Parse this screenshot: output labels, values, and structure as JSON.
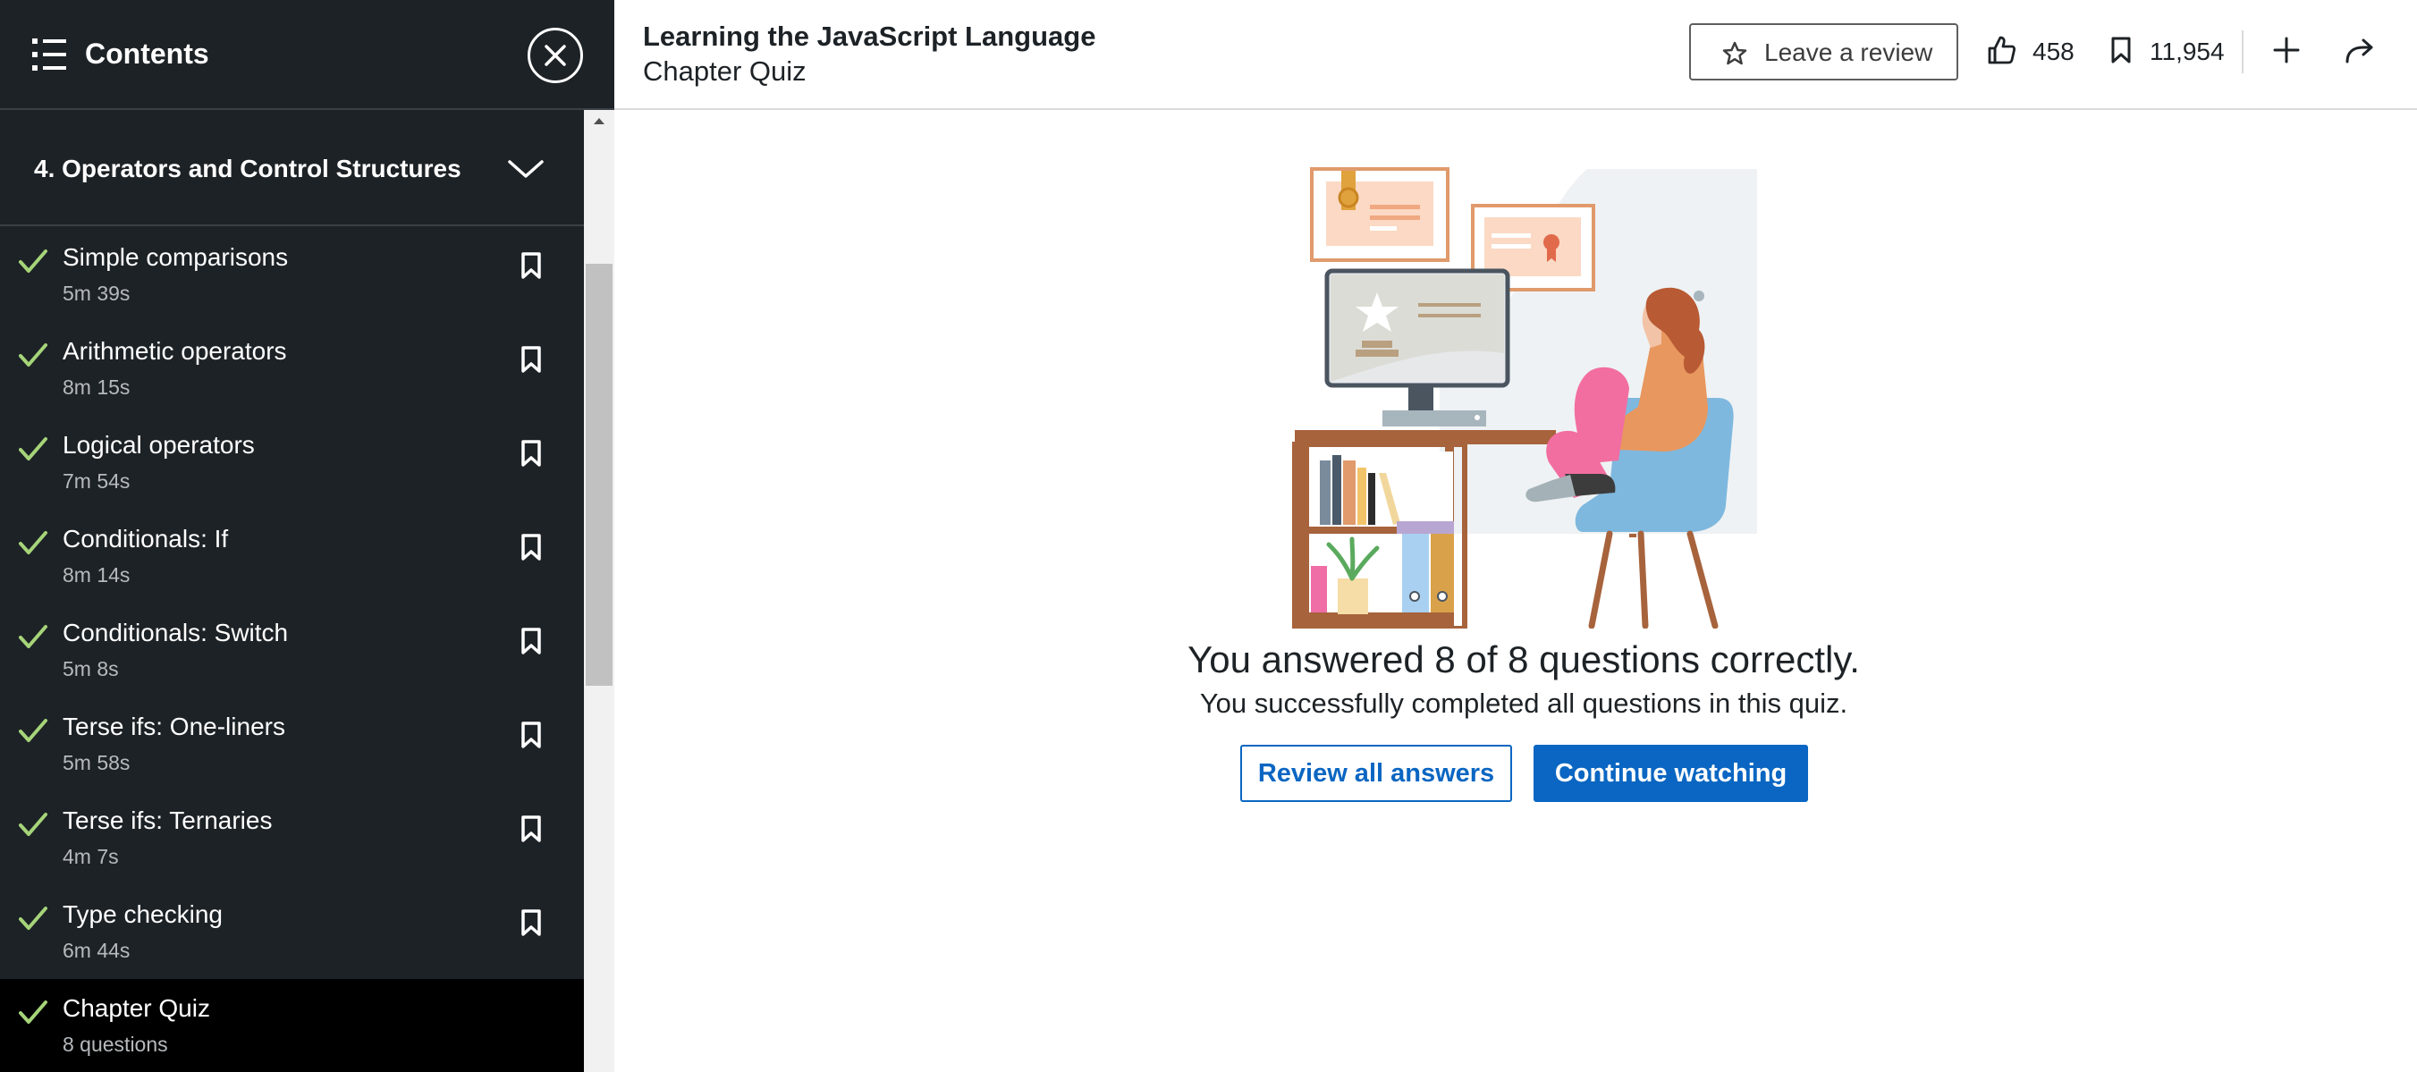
{
  "sidebar": {
    "title": "Contents",
    "section_title": "4. Operators and Control Structures",
    "items": [
      {
        "name": "Simple comparisons",
        "duration": "5m 39s"
      },
      {
        "name": "Arithmetic operators",
        "duration": "8m 15s"
      },
      {
        "name": "Logical operators",
        "duration": "7m 54s"
      },
      {
        "name": "Conditionals: If",
        "duration": "8m 14s"
      },
      {
        "name": "Conditionals: Switch",
        "duration": "5m 8s"
      },
      {
        "name": "Terse ifs: One-liners",
        "duration": "5m 58s"
      },
      {
        "name": "Terse ifs: Ternaries",
        "duration": "4m 7s"
      },
      {
        "name": "Type checking",
        "duration": "6m 44s"
      },
      {
        "name": "Chapter Quiz",
        "duration": "8 questions"
      }
    ]
  },
  "header": {
    "course_title": "Learning the JavaScript Language",
    "subtitle": "Chapter Quiz",
    "review_label": "Leave a review",
    "likes": "458",
    "saves": "11,954"
  },
  "quiz": {
    "result": "You answered 8 of 8 questions correctly.",
    "result_sub": "You successfully completed all questions in this quiz.",
    "review_button": "Review all answers",
    "continue_button": "Continue watching"
  },
  "colors": {
    "sidebar_bg": "#1d2226",
    "active_item_bg": "#000000",
    "check_green": "#a6d479",
    "primary_blue": "#0a66c2"
  }
}
